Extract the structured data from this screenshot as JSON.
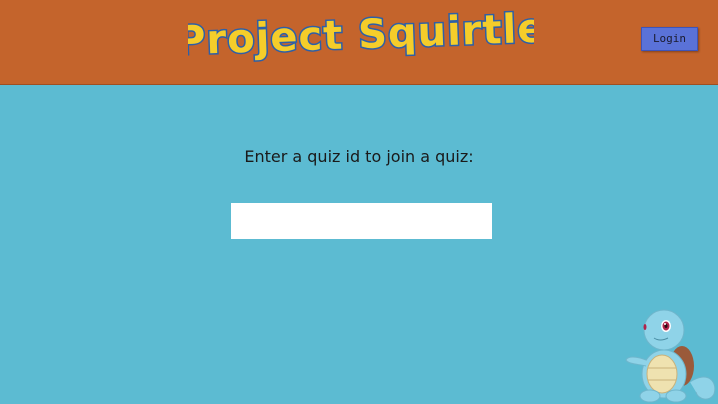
{
  "header": {
    "logo_text": "Project Squirtle",
    "login_label": "Login"
  },
  "main": {
    "prompt": "Enter a quiz id to join a quiz:",
    "quiz_input": {
      "value": "",
      "placeholder": ""
    }
  },
  "colors": {
    "header_bg": "#c4642c",
    "page_bg": "#5cbbd2",
    "login_bg": "#5a72d8",
    "logo_fill": "#f5cd2a",
    "logo_outline": "#2d5fa8"
  },
  "icons": {
    "mascot": "squirtle-mascot-icon"
  }
}
